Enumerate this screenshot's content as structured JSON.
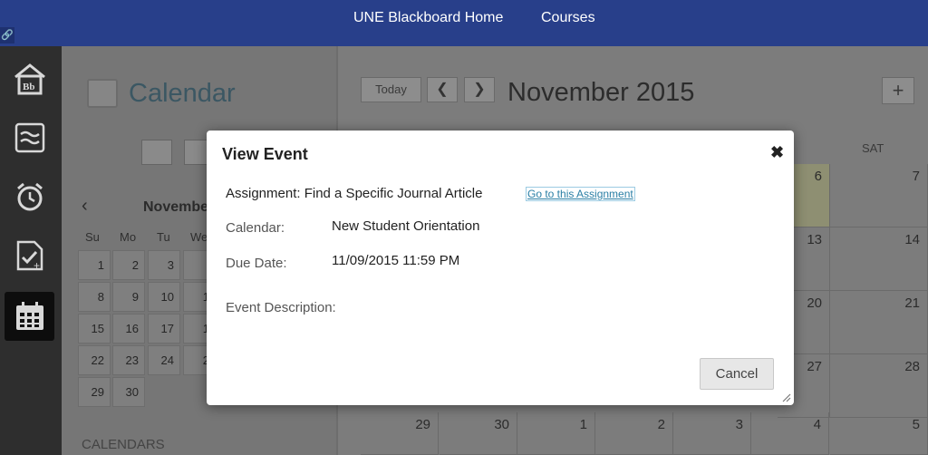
{
  "topbar": {
    "home_link": "UNE Blackboard Home",
    "courses_link": "Courses",
    "pin_icon": "link-icon"
  },
  "rail": {
    "items": [
      {
        "icon": "blackboard-home-icon"
      },
      {
        "icon": "stream-icon"
      },
      {
        "icon": "alarm-clock-icon"
      },
      {
        "icon": "grades-checklist-icon"
      },
      {
        "icon": "calendar-grid-icon",
        "active": true
      }
    ]
  },
  "sidebar": {
    "title": "Calendar",
    "mini_calendar": {
      "month_label": "November",
      "weekdays": [
        "Su",
        "Mo",
        "Tu",
        "We"
      ],
      "rows": [
        [
          "1",
          "2",
          "3",
          ""
        ],
        [
          "8",
          "9",
          "10",
          "1"
        ],
        [
          "15",
          "16",
          "17",
          "1"
        ],
        [
          "22",
          "23",
          "24",
          "2"
        ],
        [
          "29",
          "30",
          "",
          ""
        ]
      ]
    },
    "calendars_heading": "CALENDARS"
  },
  "main": {
    "today_label": "Today",
    "month_title": "November 2015",
    "saturday_header": "SAT",
    "grid_visible_days": [
      [
        "6",
        "7"
      ],
      [
        "13",
        "14"
      ],
      [
        "20",
        "21"
      ],
      [
        "27",
        "28"
      ]
    ],
    "last_row": [
      "29",
      "30",
      "1",
      "2",
      "3",
      "4",
      "5"
    ]
  },
  "modal": {
    "title": "View Event",
    "assignment_text": "Assignment: Find a Specific Journal Article",
    "assignment_link": "Go to this Assignment",
    "calendar_label": "Calendar:",
    "calendar_value": "New Student Orientation",
    "due_label": "Due Date:",
    "due_value": "11/09/2015 11:59 PM",
    "description_label": "Event Description:",
    "cancel_label": "Cancel"
  },
  "colors": {
    "topbar": "#283f8a",
    "rail": "#2e2e2e",
    "link": "#2a7fa5"
  }
}
